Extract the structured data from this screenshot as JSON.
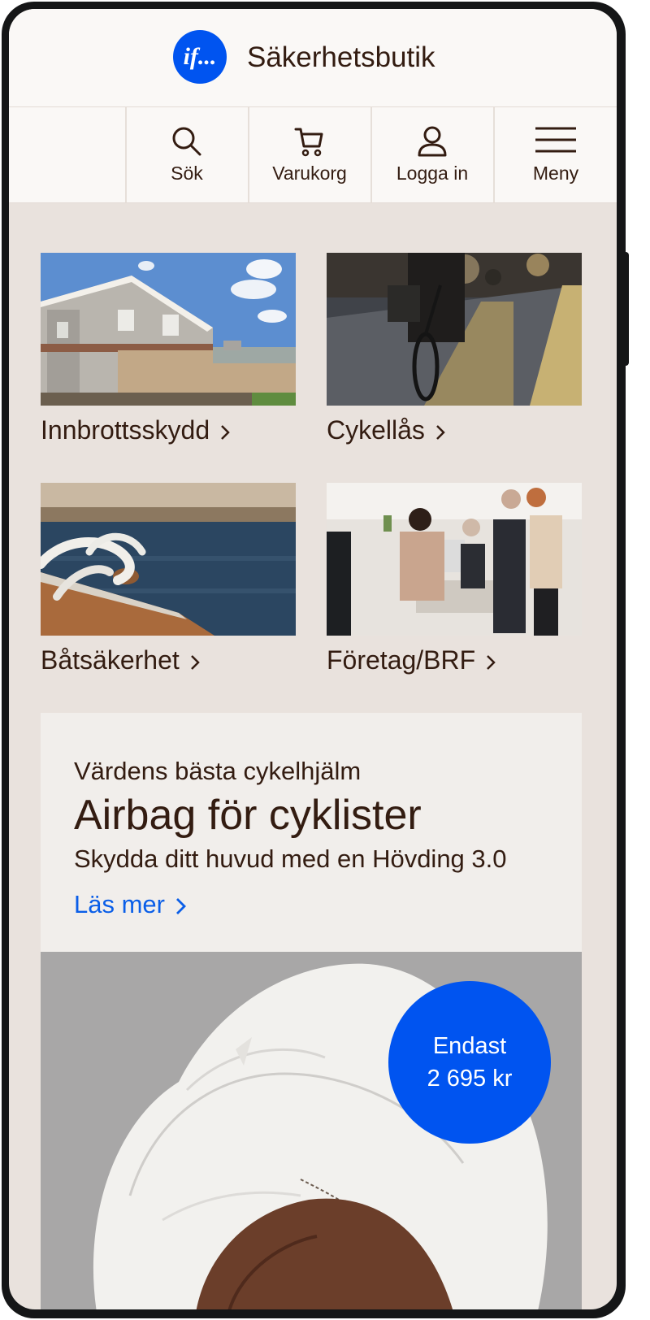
{
  "header": {
    "logo_text": "if...",
    "title": "Säkerhetsbutik"
  },
  "nav": [
    {
      "label": "Sök",
      "icon": "search-icon"
    },
    {
      "label": "Varukorg",
      "icon": "cart-icon"
    },
    {
      "label": "Logga in",
      "icon": "user-icon"
    },
    {
      "label": "Meny",
      "icon": "hamburger-menu-icon"
    }
  ],
  "categories": [
    {
      "label": "Innbrottsskydd"
    },
    {
      "label": "Cykellås"
    },
    {
      "label": "Båtsäkerhet"
    },
    {
      "label": "Företag/BRF"
    }
  ],
  "promo": {
    "kicker": "Värdens bästa cykelhjälm",
    "title": "Airbag för cyklister",
    "subtitle": "Skydda ditt huvud med en Hövding 3.0",
    "link": "Läs mer"
  },
  "price_badge": {
    "line1": "Endast",
    "line2": "2 695 kr"
  },
  "colors": {
    "brand": "#0054f0",
    "link": "#0a5ee8",
    "text": "#331c11",
    "page_bg": "#e9e2dd"
  }
}
